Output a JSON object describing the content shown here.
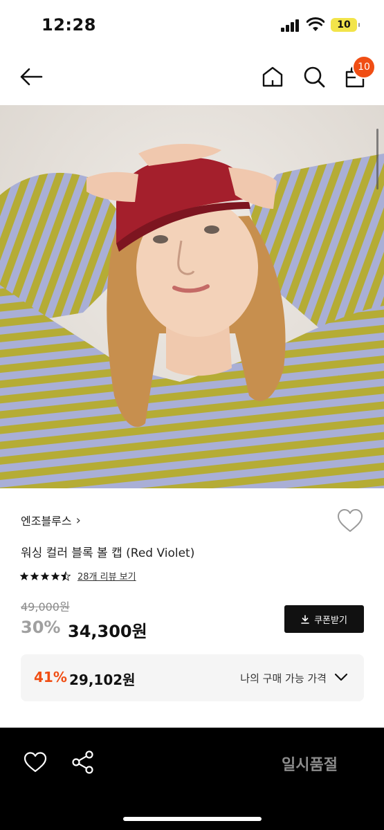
{
  "status_bar": {
    "time": "12:28",
    "battery": "10"
  },
  "nav": {
    "icons": [
      "arrow-left-icon",
      "home-icon",
      "search-icon",
      "shopping-bag-icon"
    ],
    "cart_count": "10"
  },
  "product": {
    "brand": "엔조블루스",
    "brand_chevron": "›",
    "name": "워싱 컬러 블록 볼 캡 (Red Violet)",
    "rating": 4.5,
    "review_link": "28개 리뷰 보기",
    "original_price": "49,000원",
    "discount_rate": "30%",
    "sale_price": "34,300원",
    "coupon_button": "쿠폰받기"
  },
  "my_price": {
    "rate": "41%",
    "price": "29,102원",
    "label": "나의 구매 가능 가격"
  },
  "bottom_bar": {
    "status": "일시품절",
    "icons": [
      "heart-outline-icon",
      "share-icon"
    ]
  },
  "colors": {
    "accent": "#f04e14",
    "bottom_bar": "#000000",
    "coupon_button": "#111111",
    "price_box": "#f5f5f5"
  }
}
